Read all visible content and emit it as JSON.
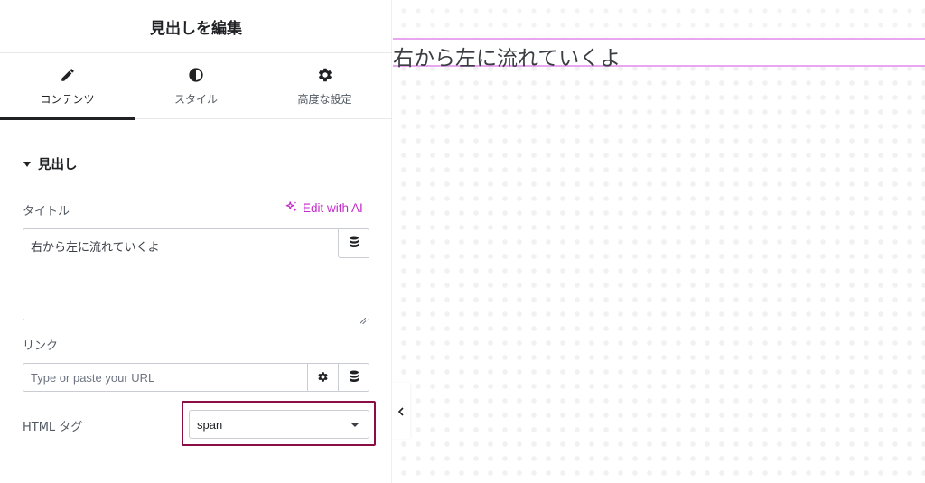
{
  "panel": {
    "title": "見出しを編集",
    "tabs": [
      {
        "label": "コンテンツ",
        "icon": "pencil-icon",
        "active": true
      },
      {
        "label": "スタイル",
        "icon": "half-circle-icon",
        "active": false
      },
      {
        "label": "高度な設定",
        "icon": "gear-icon",
        "active": false
      }
    ],
    "section_title": "見出し",
    "title_field": {
      "label": "タイトル",
      "ai_label": "Edit with AI",
      "value": "右から左に流れていくよ"
    },
    "link_field": {
      "label": "リンク",
      "placeholder": "Type or paste your URL"
    },
    "html_tag_field": {
      "label": "HTML タグ",
      "value": "span"
    }
  },
  "preview": {
    "heading_text": "右から左に流れていくよ"
  },
  "colors": {
    "accent_ai": "#c42ac9",
    "highlight_border": "#8b0d45",
    "selection_outline": "#e7a6ef"
  }
}
